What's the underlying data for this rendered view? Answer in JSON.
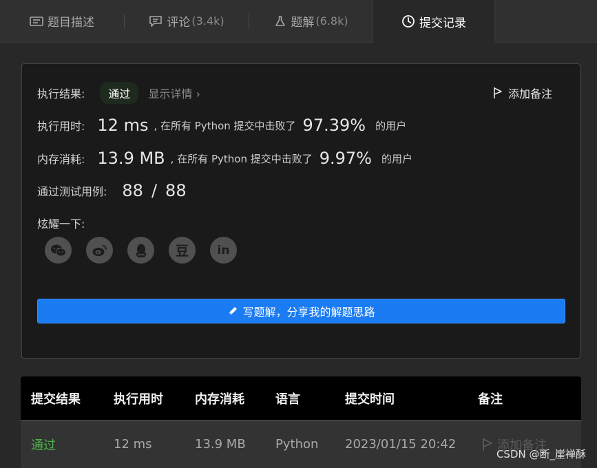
{
  "tabs": [
    {
      "label": "题目描述",
      "count": "",
      "icon": "description-icon"
    },
    {
      "label": "评论",
      "count": "(3.4k)",
      "icon": "comment-icon"
    },
    {
      "label": "题解",
      "count": "(6.8k)",
      "icon": "flask-icon"
    },
    {
      "label": "提交记录",
      "count": "",
      "icon": "clock-icon"
    }
  ],
  "result": {
    "status_label": "执行结果:",
    "status": "通过",
    "details_link": "显示详情 ›",
    "add_note": "添加备注",
    "runtime_label": "执行用时:",
    "runtime": "12 ms",
    "runtime_text": ", 在所有 Python 提交中击败了",
    "runtime_pct": "97.39%",
    "memory_label": "内存消耗:",
    "memory": "13.9 MB",
    "memory_text": ", 在所有 Python 提交中击败了",
    "memory_pct": "9.97%",
    "users_suffix": "的用户",
    "testcases_label": "通过测试用例:",
    "testcases_passed": "88",
    "testcases_sep": "/",
    "testcases_total": "88",
    "share_label": "炫耀一下:",
    "share_icons": [
      "wechat-icon",
      "weibo-icon",
      "qq-icon",
      "douban-icon",
      "linkedin-icon"
    ],
    "douban_glyph": "豆",
    "linkedin_glyph": "in",
    "write_button": "写题解，分享我的解题思路"
  },
  "submissions": {
    "headers": [
      "提交结果",
      "执行用时",
      "内存消耗",
      "语言",
      "提交时间",
      "备注"
    ],
    "rows": [
      {
        "result": "通过",
        "runtime": "12 ms",
        "memory": "13.9 MB",
        "language": "Python",
        "time": "2023/01/15 20:42",
        "note": "添加备注"
      }
    ]
  },
  "watermark": "CSDN @断_崖禅酥",
  "colors": {
    "accent": "#1a7bf2",
    "success": "#4eb04a",
    "background": "#282828",
    "panel": "#1a1a1a"
  }
}
